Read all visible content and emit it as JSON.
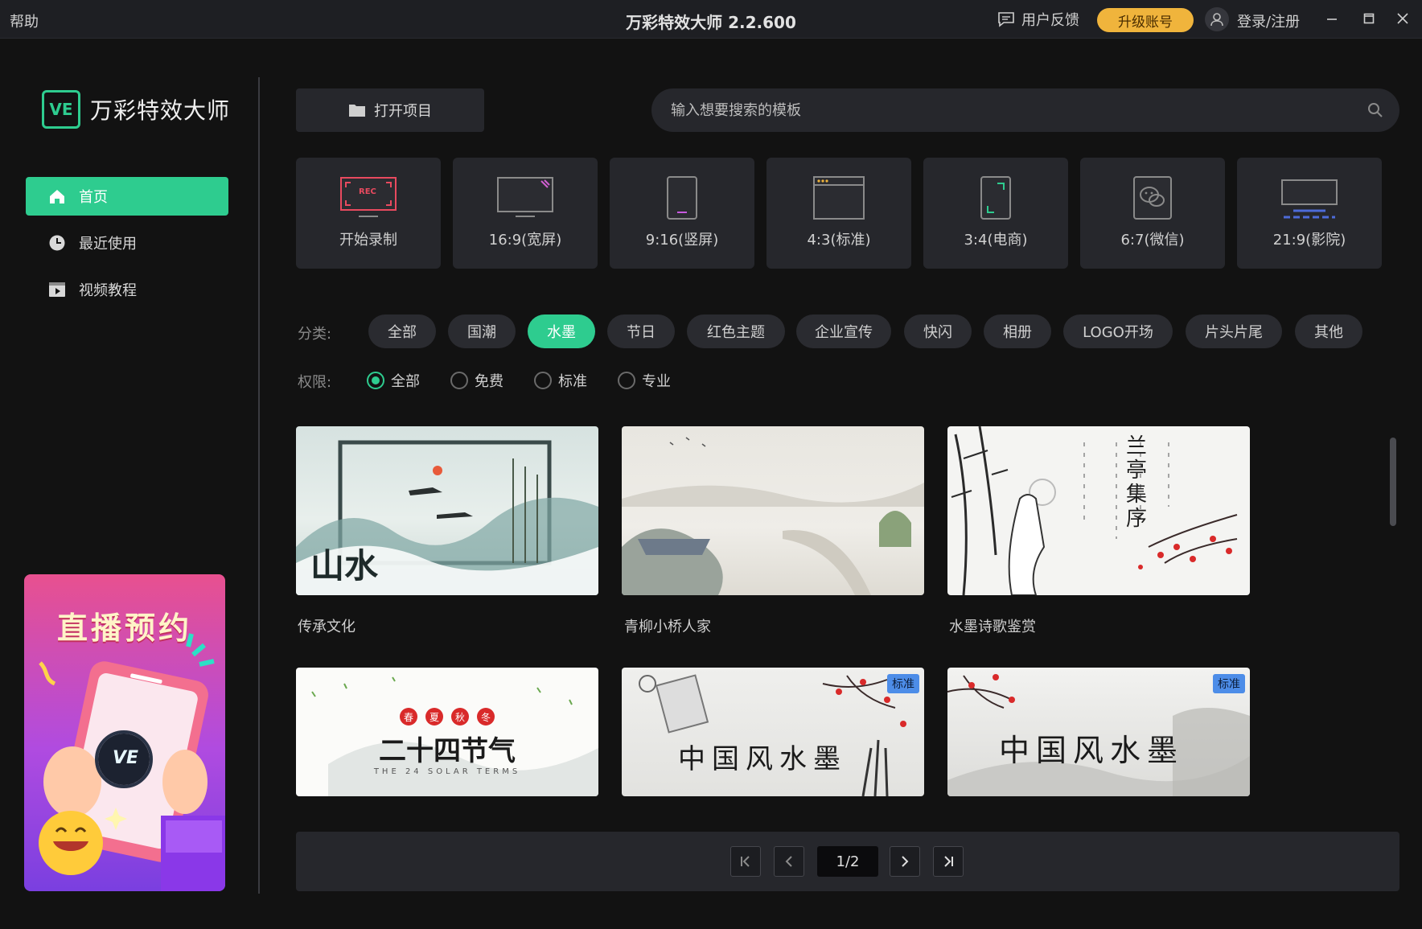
{
  "titlebar": {
    "help": "帮助",
    "title": "万彩特效大师 2.2.600",
    "feedback": "用户反馈",
    "upgrade": "升级账号",
    "login": "登录/注册"
  },
  "sidebar": {
    "logo_mark": "VE",
    "logo_text": "万彩特效大师",
    "items": [
      {
        "label": "首页",
        "icon": "home-icon",
        "active": true
      },
      {
        "label": "最近使用",
        "icon": "clock-icon",
        "active": false
      },
      {
        "label": "视频教程",
        "icon": "video-icon",
        "active": false
      }
    ],
    "promo": {
      "title": "直播预约",
      "mark": "VE"
    }
  },
  "toolbar": {
    "open_project": "打开项目",
    "search_placeholder": "输入想要搜索的模板"
  },
  "formats": [
    {
      "label": "开始录制",
      "icon": "rec-icon"
    },
    {
      "label": "16:9(宽屏)",
      "icon": "widescreen-icon"
    },
    {
      "label": "9:16(竖屏)",
      "icon": "portrait-icon"
    },
    {
      "label": "4:3(标准)",
      "icon": "standard-icon"
    },
    {
      "label": "3:4(电商)",
      "icon": "ecommerce-icon"
    },
    {
      "label": "6:7(微信)",
      "icon": "wechat-icon"
    },
    {
      "label": "21:9(影院)",
      "icon": "cinema-icon"
    }
  ],
  "filters": {
    "category_label": "分类:",
    "categories": [
      "全部",
      "国潮",
      "水墨",
      "节日",
      "红色主题",
      "企业宣传",
      "快闪",
      "相册",
      "LOGO开场",
      "片头片尾",
      "其他"
    ],
    "active_category": "水墨",
    "permission_label": "权限:",
    "permissions": [
      "全部",
      "免费",
      "标准",
      "专业"
    ],
    "active_permission": "全部"
  },
  "templates": [
    {
      "name": "传承文化",
      "thumb_text": "山水"
    },
    {
      "name": "青柳小桥人家",
      "thumb_text": ""
    },
    {
      "name": "水墨诗歌鉴赏",
      "thumb_text": "兰亭集序"
    },
    {
      "name": "",
      "thumb_text": "二十四节气",
      "thumb_sub": "THE 24 SOLAR TERMS",
      "thumb_seals": [
        "春",
        "夏",
        "秋",
        "冬"
      ]
    },
    {
      "name": "",
      "thumb_text": "中国风水墨",
      "badge": "标准"
    },
    {
      "name": "",
      "thumb_text": "中国风水墨",
      "badge": "标准"
    }
  ],
  "pagination": {
    "current": "1/2"
  },
  "colors": {
    "accent": "#2ecc8f",
    "upgrade": "#f0b43c",
    "badge": "#4d8de8",
    "background": "#121212",
    "card": "#26272c"
  }
}
